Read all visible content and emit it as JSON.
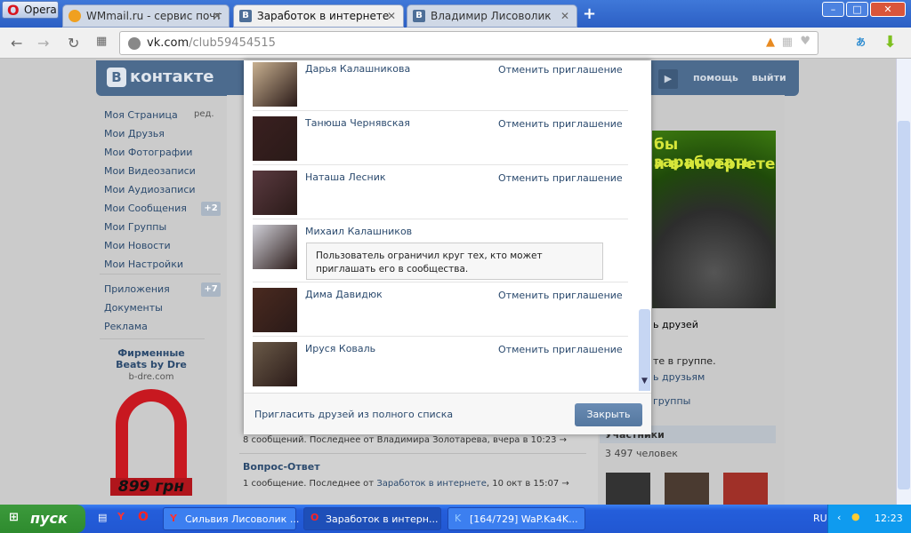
{
  "browser": {
    "menu_label": "Opera",
    "tabs": [
      {
        "title": "WMmail.ru - сервис почт",
        "icon": "wmmail-icon"
      },
      {
        "title": "Заработок в интернете",
        "icon": "vk-icon"
      },
      {
        "title": "Владимир Лисоволик",
        "icon": "vk-icon"
      }
    ],
    "url_domain": "vk.com",
    "url_path": "/club59454515"
  },
  "vk": {
    "logo": "контакте",
    "logo_letter": "В",
    "help": "помощь",
    "logout": "выйти",
    "menu": [
      {
        "label": "Моя Страница",
        "extra": "ред."
      },
      {
        "label": "Мои Друзья"
      },
      {
        "label": "Мои Фотографии"
      },
      {
        "label": "Мои Видеозаписи"
      },
      {
        "label": "Мои Аудиозаписи"
      },
      {
        "label": "Мои Сообщения",
        "badge": "+2"
      },
      {
        "label": "Мои Группы"
      },
      {
        "label": "Мои Новости"
      },
      {
        "label": "Мои Настройки"
      },
      {
        "label": "Приложения",
        "badge": "+7"
      },
      {
        "label": "Документы"
      },
      {
        "label": "Реклама"
      }
    ],
    "ad": {
      "title1": "Фирменные",
      "title2": "Beats by Dre",
      "domain": "b-dre.com",
      "price": "899 грн"
    },
    "banner": {
      "line1": "бы заработать",
      "line2": "и в интернете"
    },
    "right": {
      "invite_friends": "ь друзей",
      "in_group": "те в группе.",
      "tell_friends": "ь друзьям",
      "group": "группы",
      "members_title": "Участники",
      "members_count": "3 497 человек"
    },
    "topics": [
      {
        "meta": "8 сообщений. Последнее от Владимира Золотарева, вчера в 10:23 →"
      },
      {
        "title": "Вопрос-Ответ",
        "meta_prefix": "1 сообщение. Последнее от ",
        "author": "Заработок в интернете",
        "meta_suffix": ", 10 окт в 15:07 →"
      }
    ]
  },
  "modal": {
    "cancel_label": "Отменить приглашение",
    "rows": [
      {
        "name": "Дарья Калашникова"
      },
      {
        "name": "Танюша Чернявская"
      },
      {
        "name": "Наташа Лесник"
      },
      {
        "name": "Михаил Калашников",
        "restricted": "Пользователь ограничил круг тех, кто может приглашать его в сообщества."
      },
      {
        "name": "Дима Давидюк"
      },
      {
        "name": "Ируся Коваль"
      }
    ],
    "invite_full_list": "Пригласить друзей из полного списка",
    "close": "Закрыть"
  },
  "taskbar": {
    "start": "пуск",
    "tasks": [
      "Сильвия Лисоволик ...",
      "Заработок в интерн...",
      "[164/729] WaP.Ka4K..."
    ],
    "lang": "RU",
    "time": "12:23"
  }
}
